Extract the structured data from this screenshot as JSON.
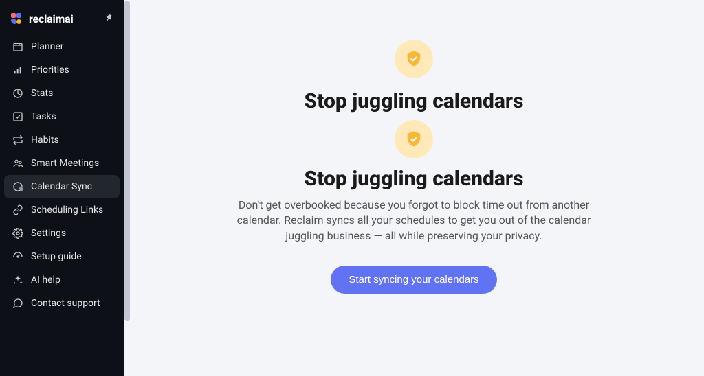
{
  "brand": {
    "name": "reclaimai"
  },
  "sidebar": {
    "items": [
      {
        "label": "Planner"
      },
      {
        "label": "Priorities"
      },
      {
        "label": "Stats"
      },
      {
        "label": "Tasks"
      },
      {
        "label": "Habits"
      },
      {
        "label": "Smart Meetings"
      },
      {
        "label": "Calendar Sync"
      },
      {
        "label": "Scheduling Links"
      },
      {
        "label": "Settings"
      },
      {
        "label": "Setup guide"
      },
      {
        "label": "AI help"
      },
      {
        "label": "Contact support"
      }
    ],
    "active_index": 6
  },
  "hero": {
    "title1": "Stop juggling calendars",
    "title2": "Stop juggling calendars",
    "description": "Don't get overbooked because you forgot to block time out from another calendar. Reclaim syncs all your schedules to get you out of the calendar juggling business — all while preserving your privacy.",
    "cta": "Start syncing your calendars"
  },
  "colors": {
    "accent": "#6172f3",
    "sidebar_bg": "#0d1117",
    "badge_bg": "#ffe9b8",
    "badge_fg": "#f8b734"
  }
}
